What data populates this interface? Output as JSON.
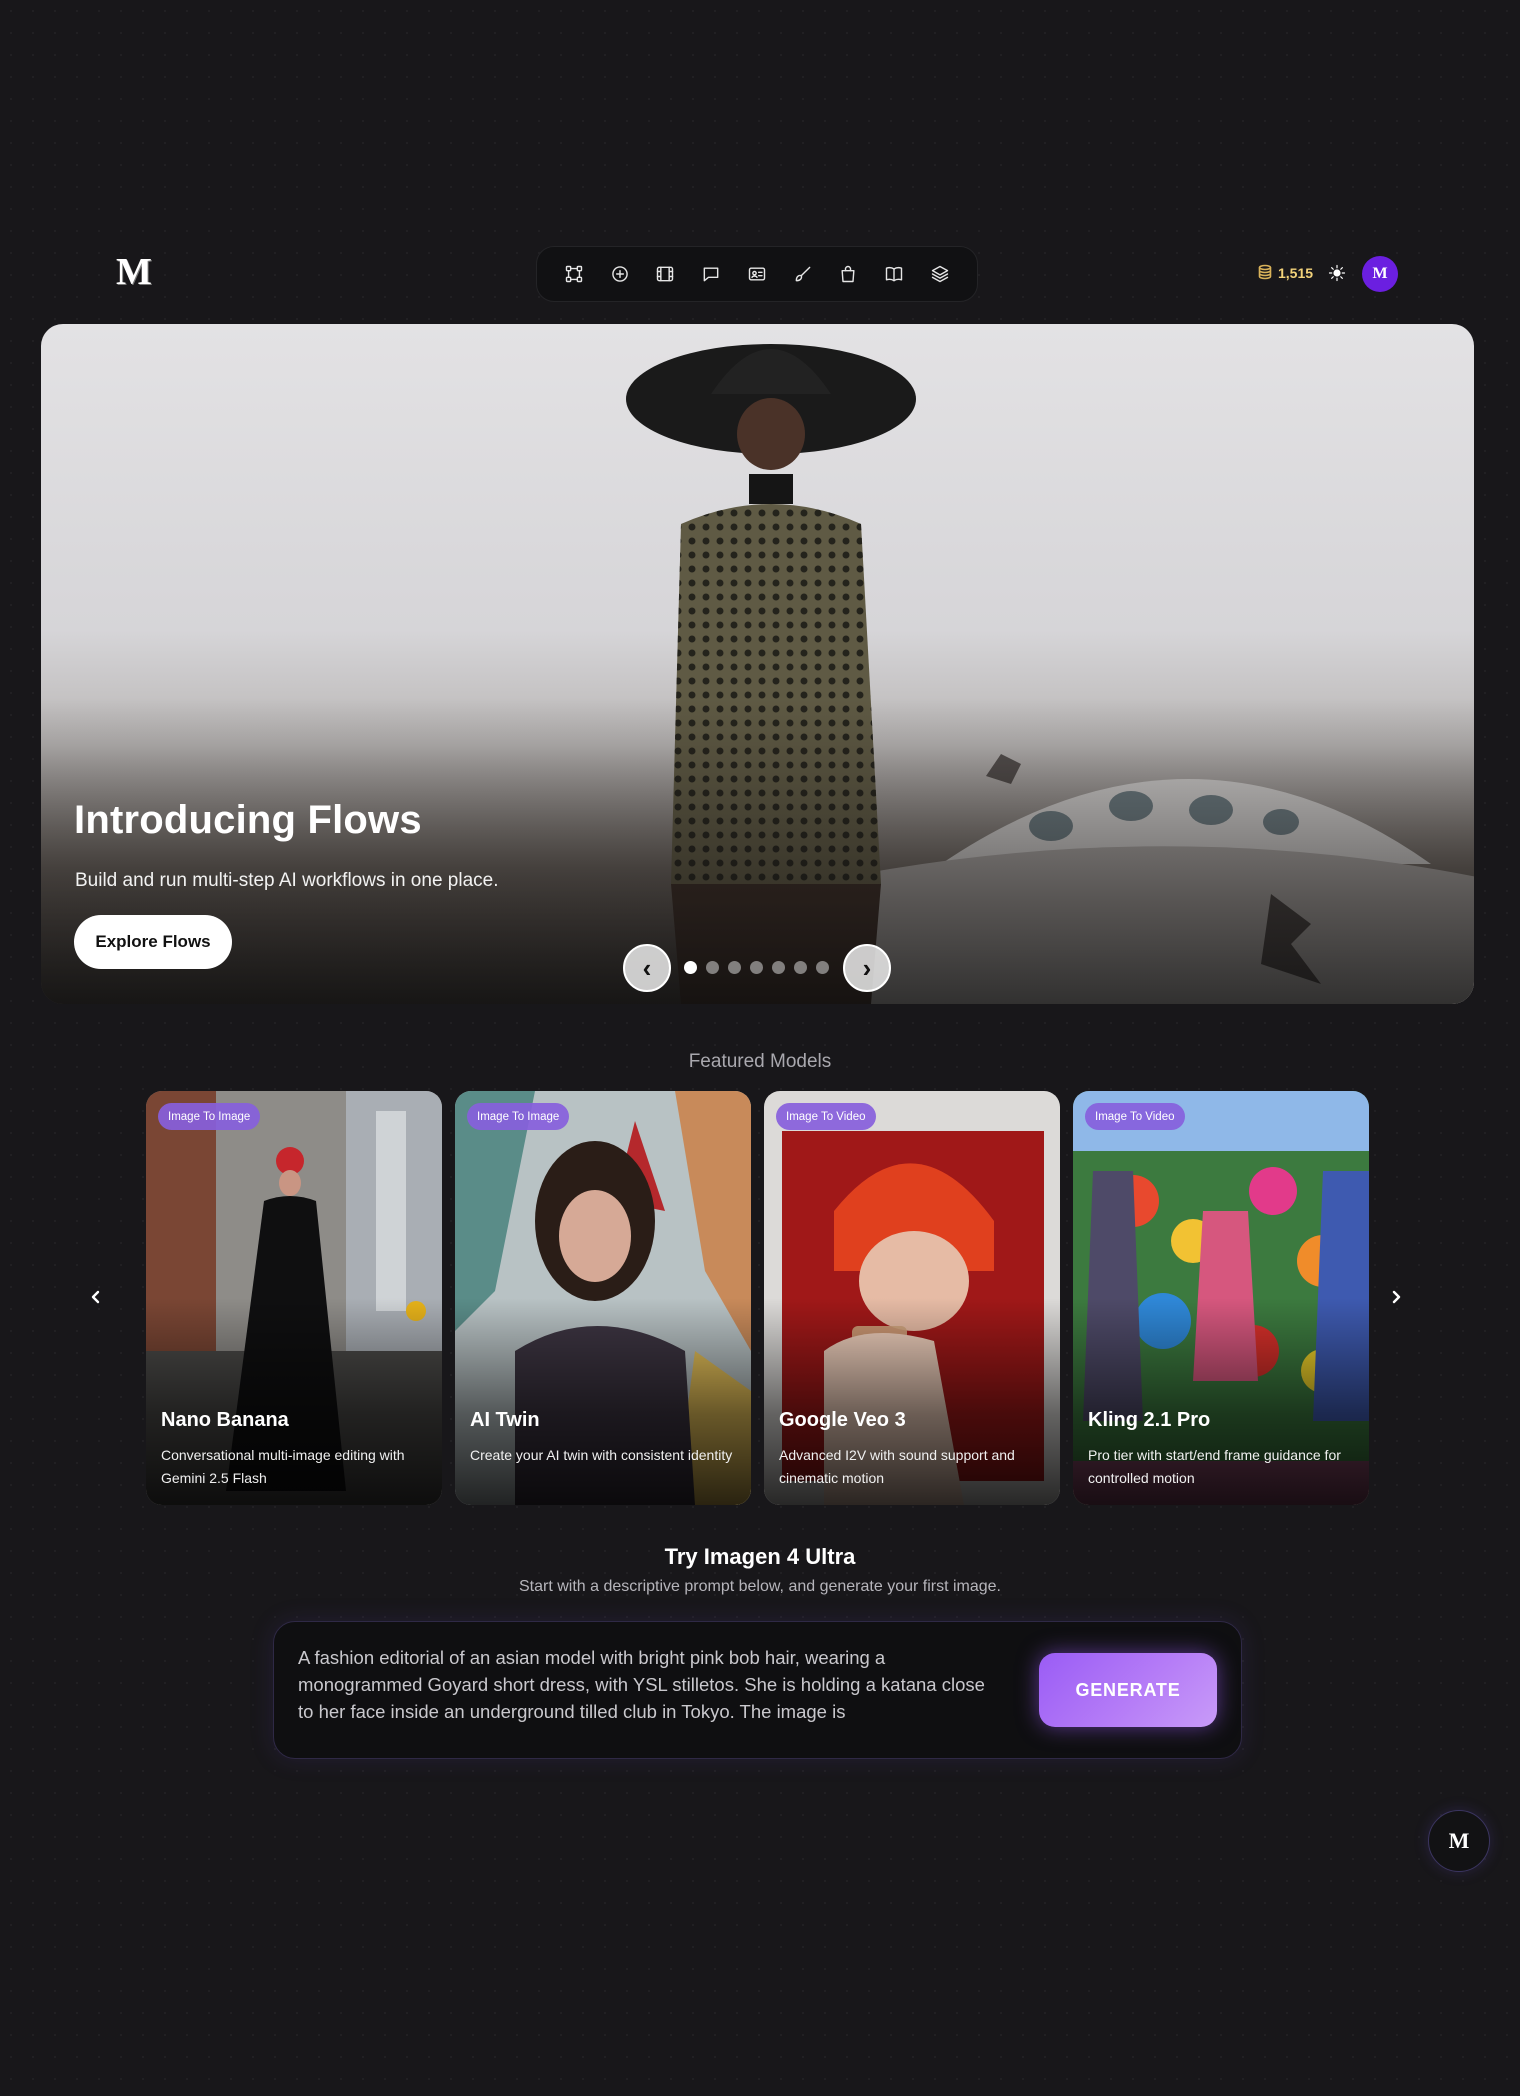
{
  "brand": {
    "logo_text": "M",
    "avatar_text": "M",
    "fab_text": "M"
  },
  "toolbar": {
    "icons": [
      "flows-icon",
      "plus-circle-icon",
      "film-icon",
      "chat-icon",
      "id-card-icon",
      "brush-icon",
      "shopping-bag-icon",
      "book-icon",
      "layers-icon"
    ]
  },
  "header": {
    "credits": "1,515",
    "credits_icon": "coins-icon",
    "theme_icon": "sun-icon"
  },
  "hero": {
    "title": "Introducing Flows",
    "subtitle": "Build and run multi-step AI workflows in one place.",
    "cta": "Explore Flows",
    "prev": "‹",
    "next": "›",
    "slide_count": 7,
    "active_slide": 1
  },
  "featured": {
    "title": "Featured Models",
    "cards": [
      {
        "badge": "Image To Image",
        "name": "Nano Banana",
        "desc": "Conversational multi-image editing with Gemini 2.5 Flash"
      },
      {
        "badge": "Image To Image",
        "name": "AI Twin",
        "desc": "Create your AI twin with consistent identity"
      },
      {
        "badge": "Image To Video",
        "name": "Google Veo 3",
        "desc": "Advanced I2V with sound support and cinematic motion"
      },
      {
        "badge": "Image To Video",
        "name": "Kling 2.1 Pro",
        "desc": "Pro tier with start/end frame guidance for controlled motion"
      }
    ]
  },
  "try": {
    "title": "Try Imagen 4 Ultra",
    "subtitle": "Start with a descriptive prompt below, and generate your first image.",
    "prompt": "A fashion editorial of an asian model with bright pink bob hair, wearing a monogrammed Goyard short dress, with YSL stilletos. She is holding a katana close to her face inside an underground tilled club in Tokyo. The image is",
    "generate_label": "GENERATE"
  },
  "colors": {
    "background": "#18171a",
    "accent": "#6b1fe0",
    "badge": "#875fdc",
    "generate": "#a86cf6"
  }
}
